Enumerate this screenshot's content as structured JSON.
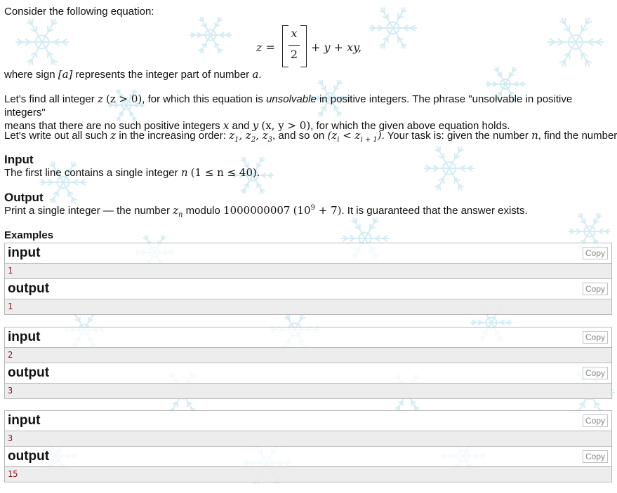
{
  "statement": {
    "intro": "Consider the following equation:",
    "where_prefix": "where sign ",
    "where_sym": "[a]",
    "where_mid": " represents the integer part of number ",
    "where_a": "a",
    "where_end": ".",
    "p2_a": "Let's find all integer ",
    "p2_z": "z",
    "p2_cond": "(z > 0)",
    "p2_b": ", for which this equation is ",
    "p2_em": "unsolvable",
    "p2_c": " in positive integers. The phrase \"unsolvable in positive integers\"",
    "p2_d": "means that there are no such positive integers ",
    "p2_x": "x",
    "p2_and": " and ",
    "p2_y": "y",
    "p2_cond2": "(x, y > 0)",
    "p2_e": ", for which the given above equation holds.",
    "p3_a": "Let's write out all such ",
    "p3_z": "z",
    "p3_b": " in the increasing order: ",
    "p3_c": ", and so on ",
    "p3_d": ". Your task is: given the number ",
    "p3_n": "n",
    "p3_e": ", find the number "
  },
  "equation": {
    "lhs": "z =",
    "num": "x",
    "den": "2",
    "rhs": "+ y + xy,"
  },
  "input_section": {
    "title": "Input",
    "text_a": "The first line contains a single integer ",
    "n": "n",
    "range": "(1 ≤ n ≤ 40)",
    "text_end": "."
  },
  "output_section": {
    "title": "Output",
    "text_a": "Print a single integer — the number ",
    "text_b": " modulo ",
    "mod": "1000000007",
    "mod_expr": "(10",
    "mod_exp": "9",
    "mod_tail": " + 7)",
    "text_c": ". It is guaranteed that the answer exists."
  },
  "examples": {
    "title": "Examples",
    "input_label": "input",
    "output_label": "output",
    "copy_label": "Copy",
    "tests": [
      {
        "input": "1",
        "output": "1"
      },
      {
        "input": "2",
        "output": "3"
      },
      {
        "input": "3",
        "output": "15"
      }
    ]
  },
  "colors": {
    "snowflake": "#cde9f2",
    "io_value": "#8b1515",
    "border": "#b9b9b9"
  }
}
